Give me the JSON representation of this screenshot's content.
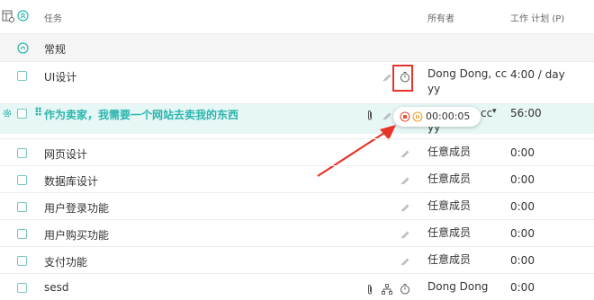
{
  "header": {
    "task_col": "任务",
    "owner_col": "所有者",
    "plan_col": "工作 计划 (P)"
  },
  "group": {
    "label": "常规"
  },
  "rows": [
    {
      "task": "UI设计",
      "owner": "Dong Dong, cc",
      "owner2": "yy",
      "plan": "4:00 / day"
    },
    {
      "task": "作为卖家，我需要一个网站去卖我的东西",
      "owner": "cc",
      "owner2": "yy",
      "plan": "56:00",
      "timer": "00:00:05"
    },
    {
      "task": "网页设计",
      "owner": "任意成员",
      "plan": "0:00"
    },
    {
      "task": "数据库设计",
      "owner": "任意成员",
      "plan": "0:00"
    },
    {
      "task": "用户登录功能",
      "owner": "任意成员",
      "plan": "0:00"
    },
    {
      "task": "用户购买功能",
      "owner": "任意成员",
      "plan": "0:00"
    },
    {
      "task": "支付功能",
      "owner": "任意成员",
      "plan": "0:00"
    },
    {
      "task": "sesd",
      "owner": "Dong Dong",
      "plan": "0:00"
    }
  ],
  "colors": {
    "accent": "#2bb5ad",
    "highlight_row": "#e6f7f6",
    "annotation_red": "#e8332a",
    "stop_icon": "#e5533c",
    "pause_icon": "#f0a030"
  },
  "icons": {
    "columns": "columns-settings-icon",
    "collapse_all": "collapse-all-icon",
    "group_toggle": "group-collapse-icon",
    "timer": "stopwatch-icon",
    "attach": "paperclip-icon",
    "edit": "pen-icon",
    "subtask": "hierarchy-icon",
    "gear": "gear-icon",
    "drag": "drag-handle-icon"
  }
}
